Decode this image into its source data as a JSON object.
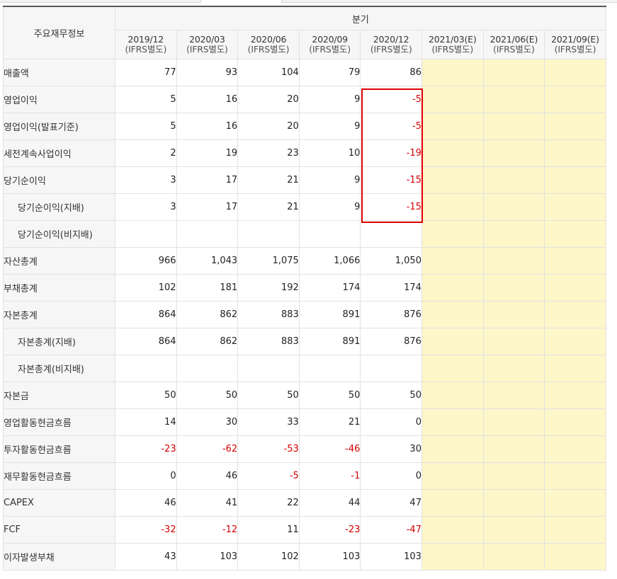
{
  "header": {
    "row_header": "주요재무정보",
    "group_label": "분기",
    "periods": [
      {
        "date": "2019/12",
        "basis": "(IFRS별도)"
      },
      {
        "date": "2020/03",
        "basis": "(IFRS별도)"
      },
      {
        "date": "2020/06",
        "basis": "(IFRS별도)"
      },
      {
        "date": "2020/09",
        "basis": "(IFRS별도)"
      },
      {
        "date": "2020/12",
        "basis": "(IFRS별도)"
      },
      {
        "date": "2021/03(E)",
        "basis": "(IFRS별도)"
      },
      {
        "date": "2021/06(E)",
        "basis": "(IFRS별도)"
      },
      {
        "date": "2021/09(E)",
        "basis": "(IFRS별도)"
      }
    ]
  },
  "rows": [
    {
      "label": "매출액",
      "values": [
        "77",
        "93",
        "104",
        "79",
        "86"
      ]
    },
    {
      "label": "영업이익",
      "values": [
        "5",
        "16",
        "20",
        "9",
        "-5"
      ]
    },
    {
      "label": "영업이익(발표기준)",
      "values": [
        "5",
        "16",
        "20",
        "9",
        "-5"
      ]
    },
    {
      "label": "세전계속사업이익",
      "values": [
        "2",
        "19",
        "23",
        "10",
        "-19"
      ]
    },
    {
      "label": "당기순이익",
      "values": [
        "3",
        "17",
        "21",
        "9",
        "-15"
      ]
    },
    {
      "label": "당기순이익(지배)",
      "values": [
        "3",
        "17",
        "21",
        "9",
        "-15"
      ]
    },
    {
      "label": "당기순이익(비지배)",
      "values": [
        "",
        "",
        "",
        "",
        ""
      ]
    },
    {
      "label": "자산총계",
      "values": [
        "966",
        "1,043",
        "1,075",
        "1,066",
        "1,050"
      ]
    },
    {
      "label": "부채총계",
      "values": [
        "102",
        "181",
        "192",
        "174",
        "174"
      ]
    },
    {
      "label": "자본총계",
      "values": [
        "864",
        "862",
        "883",
        "891",
        "876"
      ]
    },
    {
      "label": "자본총계(지배)",
      "values": [
        "864",
        "862",
        "883",
        "891",
        "876"
      ]
    },
    {
      "label": "자본총계(비지배)",
      "values": [
        "",
        "",
        "",
        "",
        ""
      ]
    },
    {
      "label": "자본금",
      "values": [
        "50",
        "50",
        "50",
        "50",
        "50"
      ]
    },
    {
      "label": "영업활동현금흐름",
      "values": [
        "14",
        "30",
        "33",
        "21",
        "0"
      ]
    },
    {
      "label": "투자활동현금흐름",
      "values": [
        "-23",
        "-62",
        "-53",
        "-46",
        "30"
      ]
    },
    {
      "label": "재무활동현금흐름",
      "values": [
        "0",
        "46",
        "-5",
        "-1",
        "0"
      ]
    },
    {
      "label": "CAPEX",
      "values": [
        "46",
        "41",
        "22",
        "44",
        "47"
      ]
    },
    {
      "label": "FCF",
      "values": [
        "-32",
        "-12",
        "11",
        "-23",
        "-47"
      ]
    },
    {
      "label": "이자발생부채",
      "values": [
        "43",
        "103",
        "102",
        "103",
        "103"
      ]
    }
  ],
  "colors": {
    "negative": "#d40000",
    "estimate_bg": "#fdf7c9",
    "highlight_box": "#e00000"
  }
}
